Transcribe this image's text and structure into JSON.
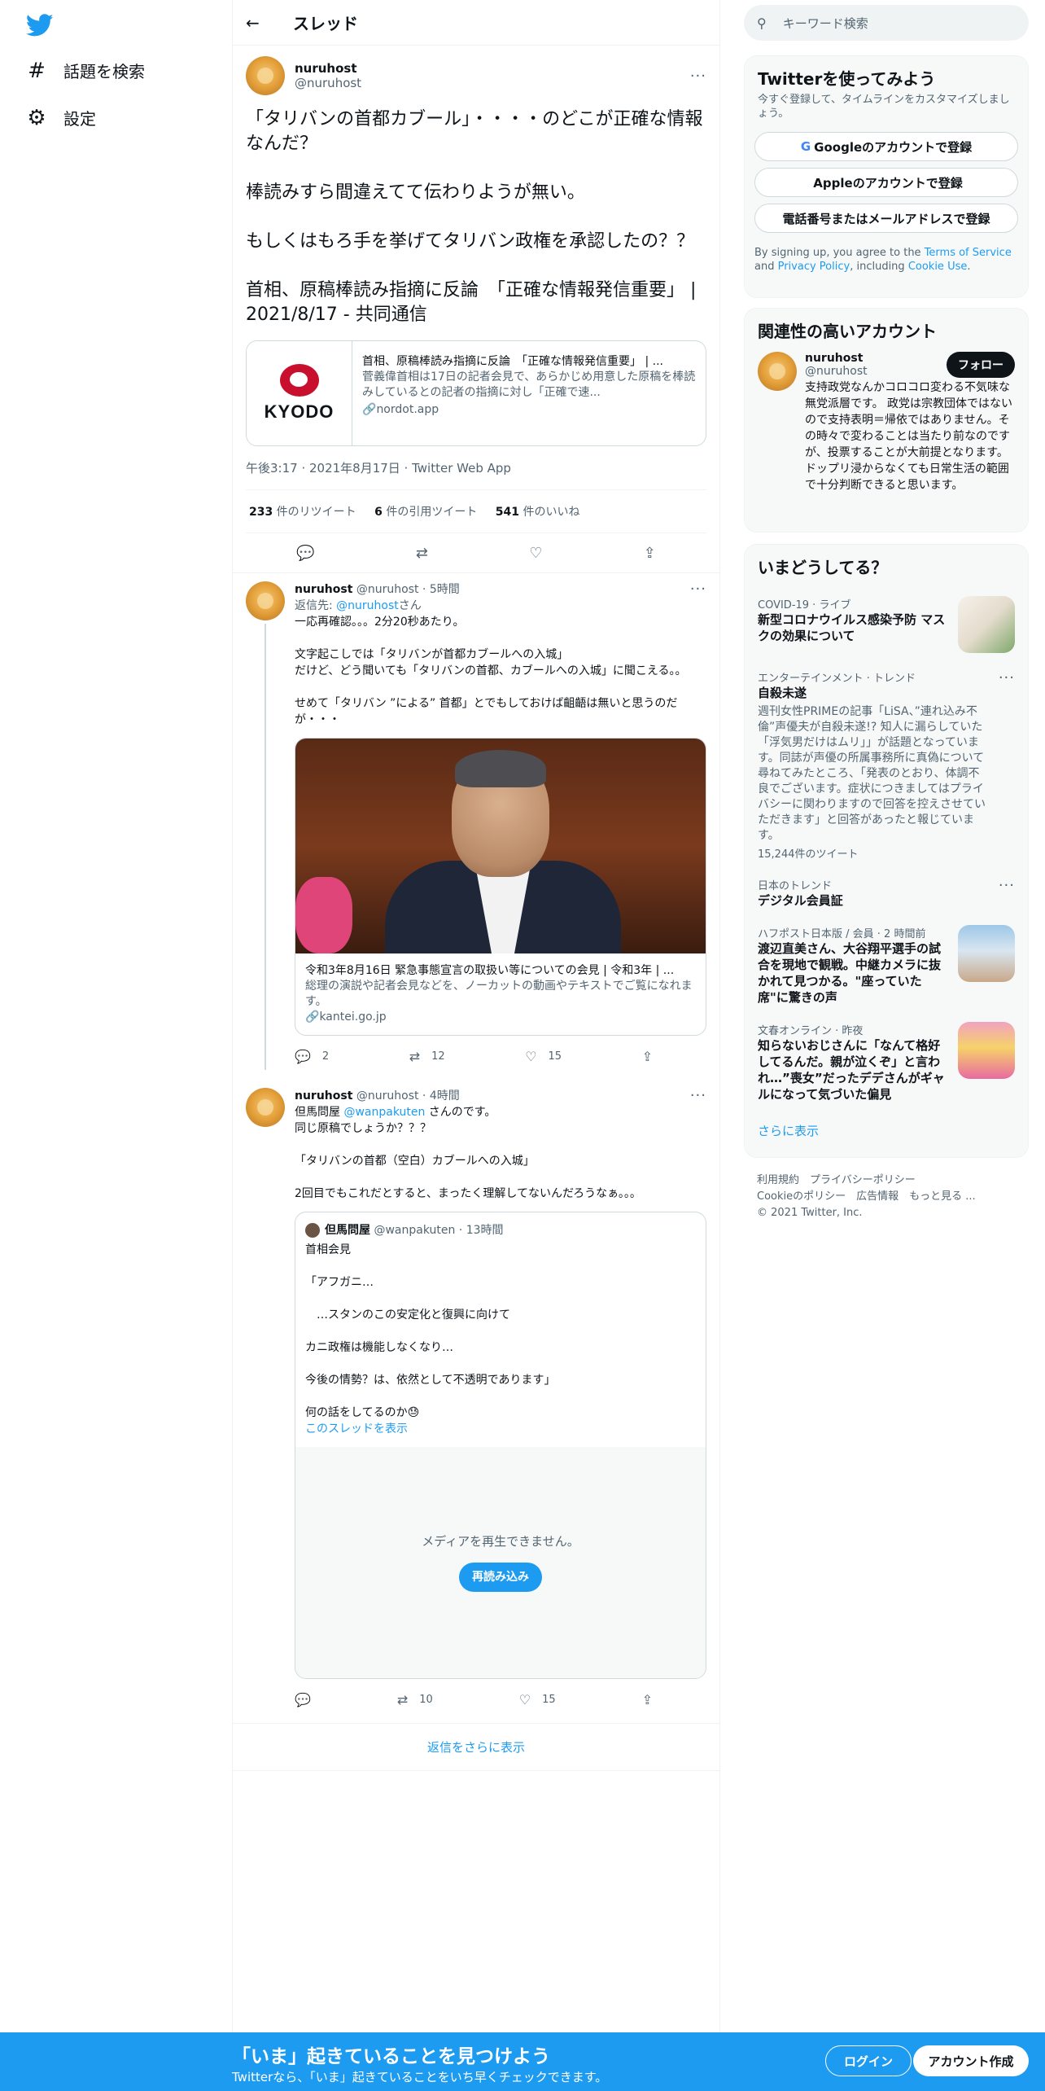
{
  "nav": {
    "explore_label": "話題を検索",
    "settings_label": "設定"
  },
  "thread": {
    "header_title": "スレッド",
    "main_tweet": {
      "name": "nuruhost",
      "handle": "@nuruhost",
      "text": "「タリバンの首都カブール」・・・・のどこが正確な情報なんだ？\n\n棒読みすら間違えてて伝わりようが無い。\n\nもしくはもろ手を挙げてタリバン政権を承認したの？？\n\n首相、原稿棒読み指摘に反論　「正確な情報発信重要」 | 2021/8/17 - 共同通信",
      "card": {
        "logo_text": "KYODO",
        "title": "首相、原稿棒読み指摘に反論　「正確な情報発信重要」 | ...",
        "description": "菅義偉首相は17日の記者会見で、あらかじめ用意した原稿を棒読みしているとの記者の指摘に対し「正確で速...",
        "url": "nordot.app"
      },
      "timestamp": "午後3:17 · 2021年8月17日 · Twitter Web App",
      "retweets_count": "233",
      "retweets_label": " 件のリツイート",
      "quotes_count": "6",
      "quotes_label": " 件の引用ツイート",
      "likes_count": "541",
      "likes_label": " 件のいいね"
    },
    "reply1": {
      "name": "nuruhost",
      "handle_time": "@nuruhost · 5時間",
      "reply_to_prefix": "返信先: ",
      "reply_to_handle": "@nuruhost",
      "reply_to_suffix": "さん",
      "text": "一応再確認。。。2分20秒あたり。\n\n文字起こしでは「タリバンが首都カブールへの入城」\nだけど、どう聞いても「タリバンの首都、カブールへの入城」に聞こえる。。\n\nせめて「タリバン ”による” 首都」とでもしておけば齟齬は無いと思うのだが・・・",
      "card_title": "令和3年8月16日 緊急事態宣言の取扱い等についての会見 | 令和3年 | ...",
      "card_description": "総理の演説や記者会見などを、ノーカットの動画やテキストでご覧になれます。",
      "card_url": "kantei.go.jp",
      "retweets": "12",
      "likes": "15",
      "replies": "2"
    },
    "reply2": {
      "name": "nuruhost",
      "handle_time": "@nuruhost · 4時間",
      "text_prefix": "但馬問屋 ",
      "mention": "@wanpakuten",
      "text_suffix": " さんのです。\n同じ原稿でしょうか？？？\n\n「タリバンの首都（空白）カブールへの入城」\n\n2回目でもこれだとすると、まったく理解してないんだろうなぁ。。。",
      "quote": {
        "name": "但馬問屋",
        "handle_time": "@wanpakuten · 13時間",
        "text": "首相会見\n\n「アフガニ…\n\n　…スタンのこの安定化と復興に向けて\n\nカニ政権は機能しなくなり…\n\n今後の情勢？は、依然として不透明であります」\n\n何の話をしてるのか😓",
        "show_thread": "このスレッドを表示",
        "media_error": "メディアを再生できません。",
        "reload": "再読み込み"
      },
      "retweets": "10",
      "likes": "15"
    },
    "more_replies": "返信をさらに表示"
  },
  "sidebar": {
    "search_placeholder": "キーワード検索",
    "signup": {
      "title": "Twitterを使ってみよう",
      "subtitle": "今すぐ登録して、タイムラインをカスタマイズしましょう。",
      "google": "Googleのアカウントで登録",
      "apple": "Appleのアカウントで登録",
      "phone": "電話番号またはメールアドレスで登録",
      "legal_1": "By signing up, you agree to the ",
      "tos": "Terms of Service",
      "legal_2": " and ",
      "privacy": "Privacy Policy",
      "legal_3": ", including ",
      "cookie": "Cookie Use",
      "legal_4": "."
    },
    "relevant": {
      "title": "関連性の高いアカウント",
      "name": "nuruhost",
      "handle": "@nuruhost",
      "follow": "フォロー",
      "bio": "支持政党なんかコロコロ変わる不気味な無党派層です。 政党は宗教団体ではないので支持表明＝帰依ではありません。その時々で変わることは当たり前なのですが、投票することが大前提となります。 ドップリ浸からなくても日常生活の範囲で十分判断できると思います。"
    },
    "trends": {
      "title": "いまどうしてる？",
      "items": [
        {
          "source": "COVID-19 · ライブ",
          "title": "新型コロナウイルス感染予防 マスクの効果について"
        },
        {
          "source": "エンターテインメント · トレンド",
          "title": "自殺未遂",
          "desc": "週刊女性PRIMEの記事「LiSA、”連れ込み不倫”声優夫が自殺未遂!? 知人に漏らしていた「浮気男だけはムリ」」が話題となっています。同誌が声優の所属事務所に真偽について尋ねてみたところ、「発表のとおり、体調不良でございます。症状につきましてはプライバシーに関わりますので回答を控えさせていただきます」と回答があったと報じています。",
          "count": "15,244件のツイート"
        },
        {
          "source": "日本のトレンド",
          "title": "デジタル会員証"
        },
        {
          "source": "ハフポスト日本版 / 会員 · 2 時間前",
          "title": "渡辺直美さん、大谷翔平選手の試合を現地で観戦。中継カメラに抜かれて見つかる。\"座っていた席\"に驚きの声"
        },
        {
          "source": "文春オンライン · 昨夜",
          "title": "知らないおじさんに「なんて格好してるんだ。親が泣くぞ」と言われ…”喪女”だったデデさんがギャルになって気づいた偏見"
        }
      ],
      "show_more": "さらに表示"
    },
    "footer": {
      "line1": "利用規約　プライバシーポリシー",
      "line2": "Cookieのポリシー　広告情報　もっと見る ...",
      "line3": "© 2021 Twitter, Inc."
    }
  },
  "bottom_bar": {
    "title": "「いま」起きていることを見つけよう",
    "subtitle": "Twitterなら、「いま」起きていることをいち早くチェックできます。",
    "login": "ログイン",
    "signup": "アカウント作成"
  },
  "colors": {
    "accent": "#1d9bf0",
    "text": "#0f1419",
    "muted": "#536471",
    "border": "#eff3f4"
  }
}
